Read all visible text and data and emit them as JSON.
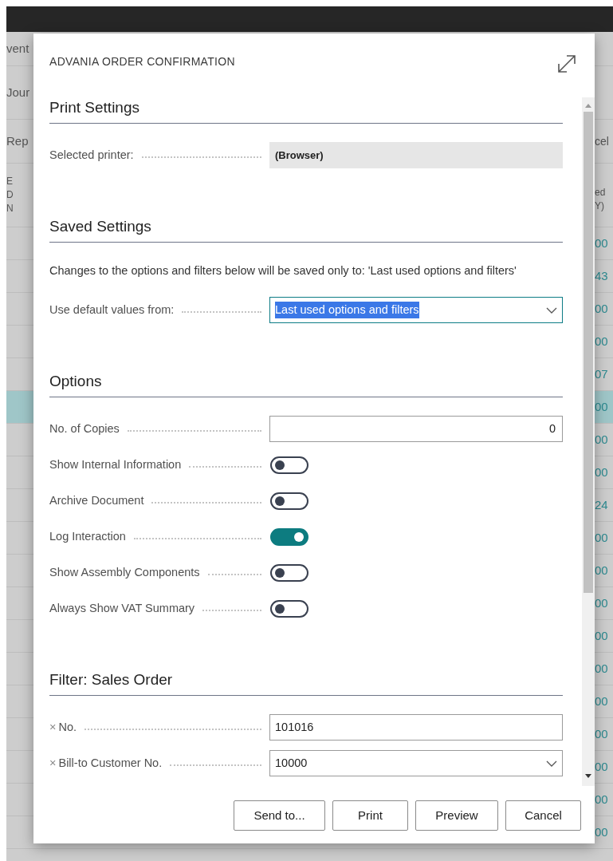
{
  "background": {
    "head_rows": [
      {
        "left": [
          "vent"
        ]
      },
      {
        "left": [
          "Jour"
        ]
      },
      {
        "left": [
          "Rep"
        ],
        "right": [
          "cel"
        ]
      },
      {
        "left": [
          "E",
          "D",
          "N"
        ],
        "right": [
          "ed",
          "Y)"
        ]
      }
    ],
    "value_rows": [
      {
        "value": "00",
        "selected": false
      },
      {
        "value": "43",
        "selected": false
      },
      {
        "value": "00",
        "selected": false
      },
      {
        "value": "00",
        "selected": false
      },
      {
        "value": "07",
        "selected": false
      },
      {
        "value": "00",
        "selected": true
      },
      {
        "value": "00",
        "selected": false
      },
      {
        "value": "00",
        "selected": false
      },
      {
        "value": "24",
        "selected": false
      },
      {
        "value": "00",
        "selected": false
      },
      {
        "value": "00",
        "selected": false
      },
      {
        "value": "00",
        "selected": false
      },
      {
        "value": "00",
        "selected": false
      },
      {
        "value": "00",
        "selected": false
      },
      {
        "value": "00",
        "selected": false
      },
      {
        "value": "00",
        "selected": false
      },
      {
        "value": "00",
        "selected": false
      },
      {
        "value": "00",
        "selected": false
      },
      {
        "value": "00",
        "selected": false
      }
    ]
  },
  "dialog": {
    "title": "ADVANIA ORDER CONFIRMATION",
    "sections": [
      {
        "heading": "Print Settings",
        "fields": [
          {
            "kind": "readonly",
            "label": "Selected printer:",
            "value": "(Browser)"
          }
        ]
      },
      {
        "heading": "Saved Settings",
        "note": "Changes to the options and filters below will be saved only to: 'Last used options and filters'",
        "fields": [
          {
            "kind": "select",
            "label": "Use default values from:",
            "value": "Last used options and filters",
            "text_selected": true
          }
        ]
      },
      {
        "heading": "Options",
        "fields": [
          {
            "kind": "number",
            "label": "No. of Copies",
            "value": "0"
          },
          {
            "kind": "toggle",
            "label": "Show Internal Information",
            "on": false
          },
          {
            "kind": "toggle",
            "label": "Archive Document",
            "on": false
          },
          {
            "kind": "toggle",
            "label": "Log Interaction",
            "on": true
          },
          {
            "kind": "toggle",
            "label": "Show Assembly Components",
            "on": false
          },
          {
            "kind": "toggle",
            "label": "Always Show VAT Summary",
            "on": false
          }
        ]
      },
      {
        "heading": "Filter: Sales Order",
        "fields": [
          {
            "kind": "text",
            "prefix": "×",
            "label": "No.",
            "value": "101016"
          },
          {
            "kind": "select",
            "prefix": "×",
            "label": "Bill-to Customer No.",
            "value": "10000",
            "text_selected": false
          }
        ]
      }
    ],
    "buttons": [
      "Send to...",
      "Print",
      "Preview",
      "Cancel"
    ]
  }
}
